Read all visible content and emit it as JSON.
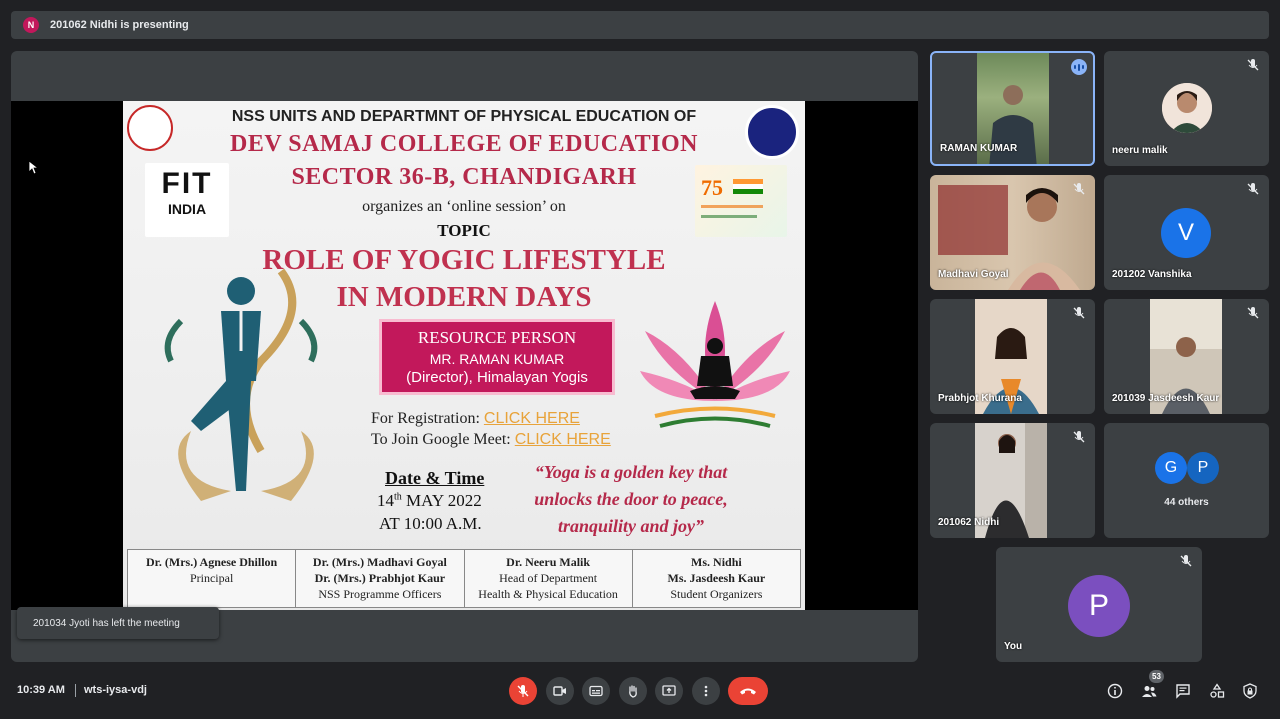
{
  "top_banner": {
    "avatar_letter": "N",
    "text": "201062 Nidhi is presenting"
  },
  "slide": {
    "header": "NSS UNITS AND DEPARTMNT OF PHYSICAL EDUCATION OF",
    "college_line1": "DEV SAMAJ COLLEGE OF EDUCATION",
    "college_line2": "SECTOR 36-B, CHANDIGARH",
    "organizes": "organizes an ‘online session’ on",
    "topic_label": "TOPIC",
    "topic_line1": "ROLE OF YOGIC LIFESTYLE",
    "topic_line2": "IN MODERN DAYS",
    "fit_logo": {
      "word": "FIT",
      "sub": "INDIA"
    },
    "resource_title": "RESOURCE PERSON",
    "resource_name": "MR. RAMAN KUMAR",
    "resource_role": "(Director), Himalayan Yogis",
    "registration_label": "For Registration:",
    "registration_link": "CLICK HERE",
    "join_label": "To Join Google Meet:",
    "join_link": "CLICK HERE",
    "date_heading": "Date & Time",
    "date_day": "14",
    "date_suffix": "th",
    "date_rest": "MAY 2022",
    "time": "AT 10:00 A.M.",
    "quote": "“Yoga is a golden key that unlocks the door to peace, tranquility and joy”",
    "footer": [
      {
        "line1": "Dr. (Mrs.) Agnese Dhillon",
        "line2": "Principal",
        "line3": ""
      },
      {
        "line1": "Dr. (Mrs.) Madhavi Goyal",
        "line2": "Dr. (Mrs.) Prabhjot Kaur",
        "line3": "NSS Programme Officers"
      },
      {
        "line1": "Dr. Neeru Malik",
        "line2": "Head of Department",
        "line3": "Health & Physical Education"
      },
      {
        "line1": "Ms. Nidhi",
        "line2": "Ms. Jasdeesh Kaur",
        "line3": "Student Organizers"
      }
    ]
  },
  "participants": [
    {
      "name": "RAMAN KUMAR"
    },
    {
      "name": "neeru malik"
    },
    {
      "name": "Madhavi Goyal"
    },
    {
      "name": "201202 Vanshika",
      "avatar_letter": "V",
      "avatar_color": "#1a73e8"
    },
    {
      "name": "Prabhjot Khurana"
    },
    {
      "name": "201039 Jasdeesh Kaur"
    },
    {
      "name": "201062 Nidhi"
    },
    {
      "name": "44 others",
      "avatar_letters": [
        "G",
        "P"
      ]
    },
    {
      "name": "You",
      "avatar_letter": "P",
      "avatar_color": "#7b4fbf"
    }
  ],
  "toast": "201034 Jyoti has left the meeting",
  "bottom_bar": {
    "time": "10:39 AM",
    "meeting_code": "wts-iysa-vdj",
    "people_count": "53"
  },
  "colors": {
    "background": "#202124",
    "tile": "#3c4043",
    "red": "#ea4335",
    "accent": "#8ab4f8"
  }
}
